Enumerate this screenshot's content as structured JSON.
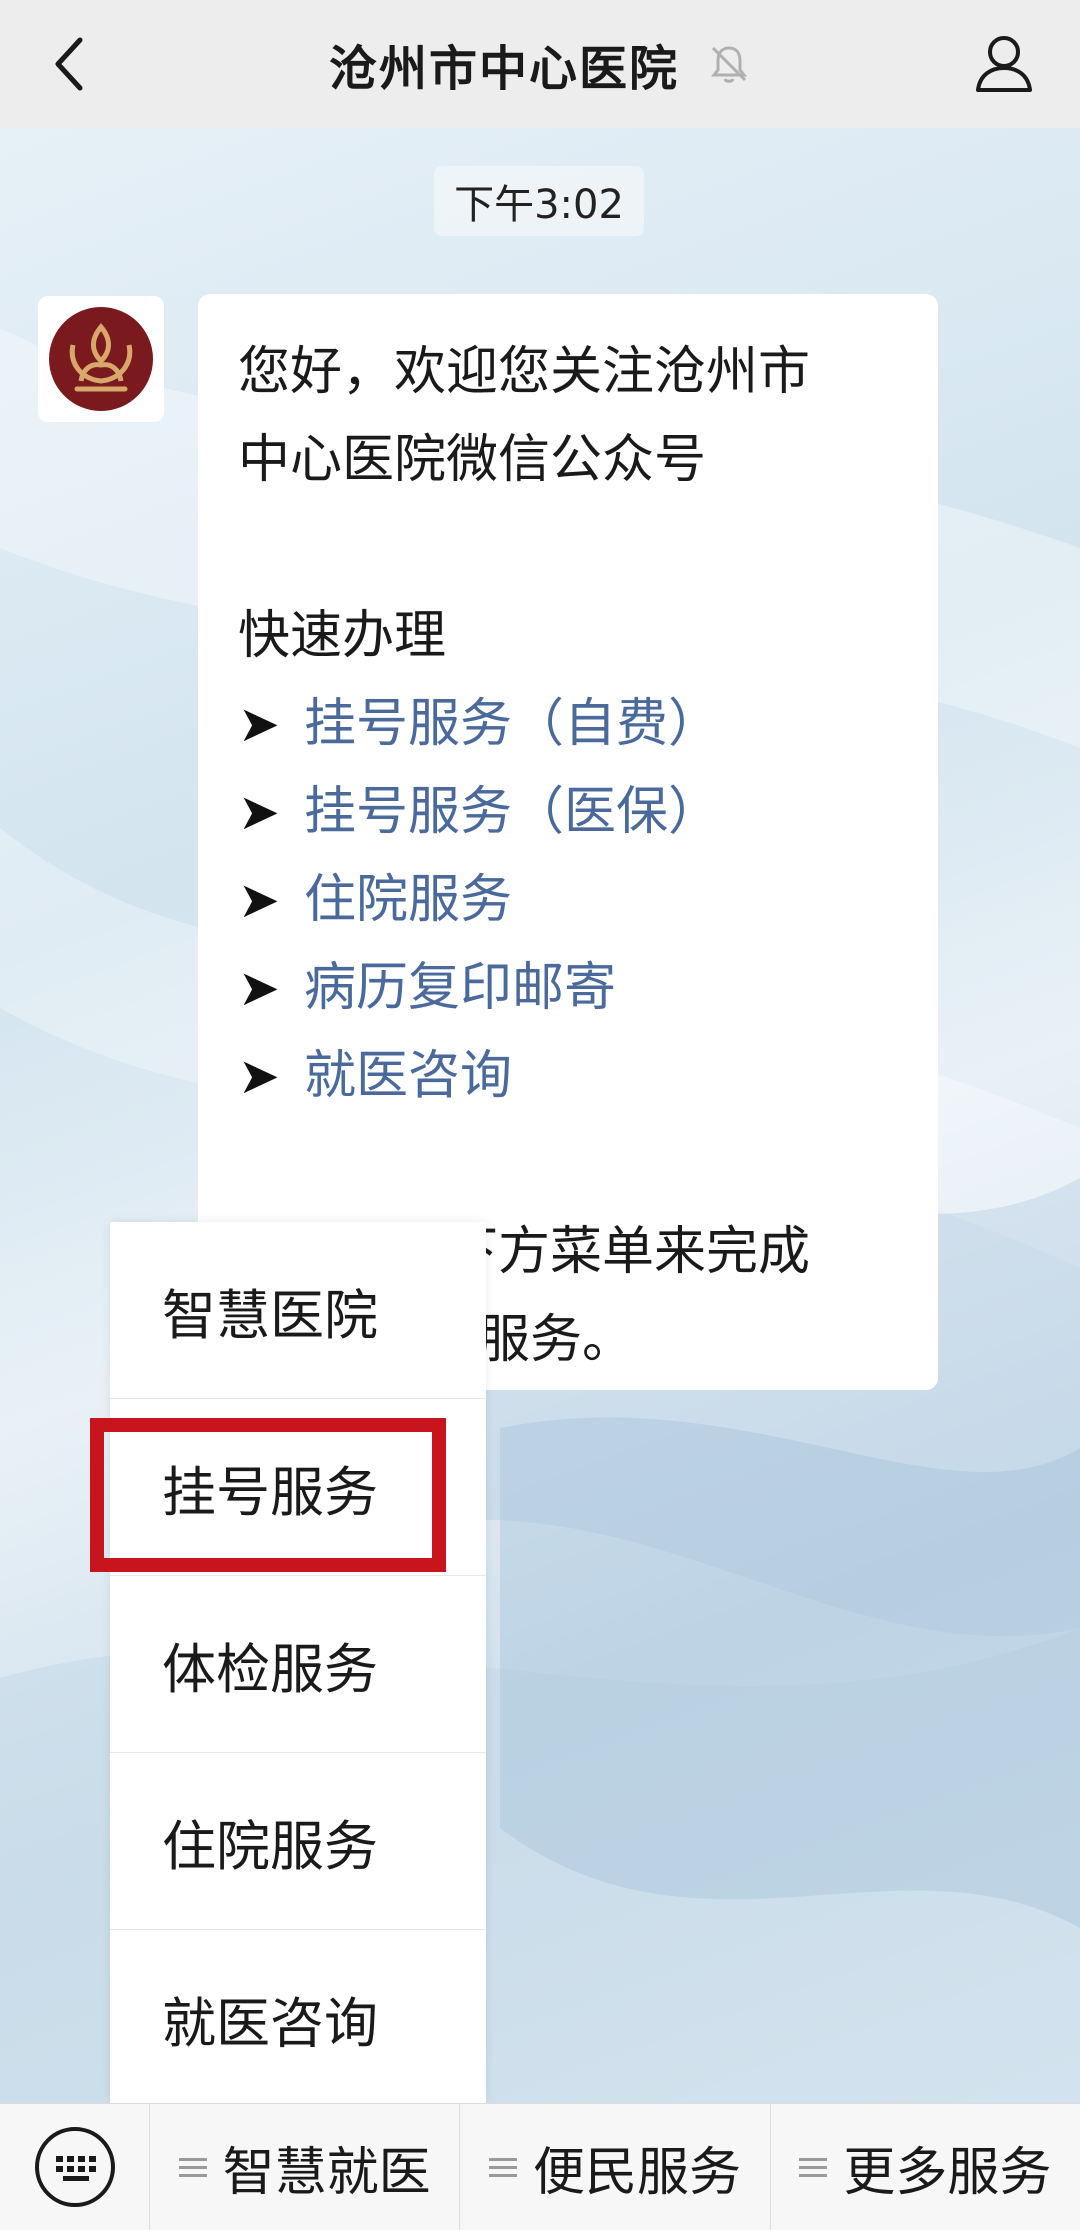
{
  "header": {
    "title": "沧州市中心医院",
    "back_icon": "chevron-left-icon",
    "mute_icon": "bell-muted-icon",
    "profile_icon": "person-icon"
  },
  "chat": {
    "timestamp": "下午3:02",
    "avatar_icon": "hospital-logo",
    "message": {
      "greeting_line1": "您好，欢迎您关注沧州市",
      "greeting_line2": "中心医院微信公众号",
      "section_title": "快速办理",
      "arrow": "➤",
      "links": [
        "挂号服务（自费）",
        "挂号服务（医保）",
        "住院服务",
        "病历复印邮寄",
        "就医咨询"
      ],
      "footer_line1": "或者使用下方菜单来完成",
      "footer_line2": "服务。"
    }
  },
  "popup_menu": {
    "items": [
      "智慧医院",
      "挂号服务",
      "体检服务",
      "住院服务",
      "就医咨询"
    ],
    "highlighted": "挂号服务",
    "highlight_color": "#c8151d"
  },
  "bottom_menu": {
    "keyboard_icon": "keyboard-icon",
    "tabs": [
      "智慧就医",
      "便民服务",
      "更多服务"
    ]
  },
  "colors": {
    "link": "#4a6a9c",
    "topbar_bg": "#ededed",
    "logo_red": "#7a1a1e",
    "logo_gold": "#d8a86a"
  }
}
